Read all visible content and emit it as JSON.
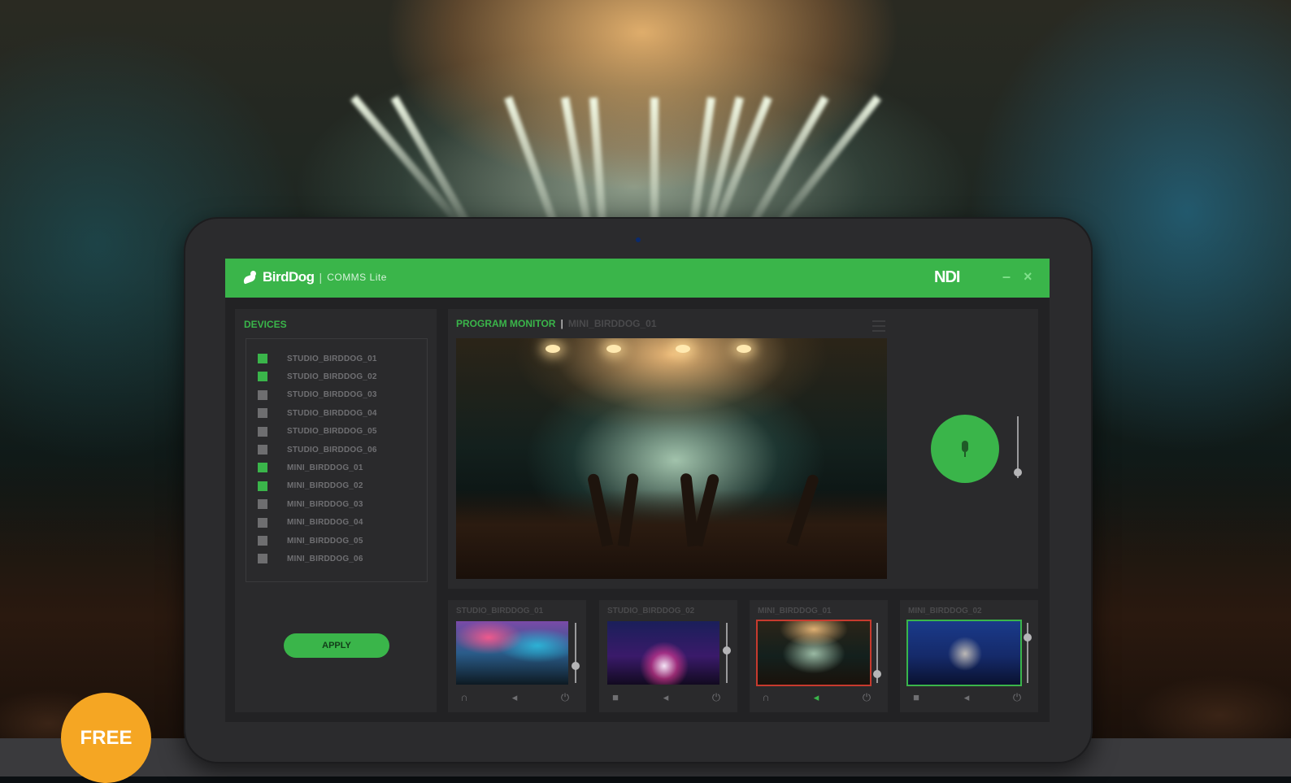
{
  "app": {
    "brand": "BirdDog",
    "separator": "|",
    "product": "COMMS Lite",
    "ndi": "NDI",
    "minimize": "–",
    "close": "×"
  },
  "devices": {
    "title": "DEVICES",
    "items": [
      {
        "label": "STUDIO_BIRDDOG_01",
        "checked": true
      },
      {
        "label": "STUDIO_BIRDDOG_02",
        "checked": true
      },
      {
        "label": "STUDIO_BIRDDOG_03",
        "checked": false
      },
      {
        "label": "STUDIO_BIRDDOG_04",
        "checked": false
      },
      {
        "label": "STUDIO_BIRDDOG_05",
        "checked": false
      },
      {
        "label": "STUDIO_BIRDDOG_06",
        "checked": false
      },
      {
        "label": "MINI_BIRDDOG_01",
        "checked": true
      },
      {
        "label": "MINI_BIRDDOG_02",
        "checked": true
      },
      {
        "label": "MINI_BIRDDOG_03",
        "checked": false
      },
      {
        "label": "MINI_BIRDDOG_04",
        "checked": false
      },
      {
        "label": "MINI_BIRDDOG_05",
        "checked": false
      },
      {
        "label": "MINI_BIRDDOG_06",
        "checked": false
      }
    ],
    "apply_label": "APPLY"
  },
  "program": {
    "label": "PROGRAM MONITOR",
    "divider": "|",
    "source": "MINI_BIRDDOG_01"
  },
  "sources": [
    {
      "name": "STUDIO_BIRDDOG_01",
      "icons": [
        "headset-icon",
        "speaker-icon",
        "power-icon"
      ],
      "active_icon": -1,
      "border": "none",
      "level": 0.25
    },
    {
      "name": "STUDIO_BIRDDOG_02",
      "icons": [
        "camera-icon",
        "speaker-icon",
        "power-icon"
      ],
      "active_icon": -1,
      "border": "none",
      "level": 0.55
    },
    {
      "name": "MINI_BIRDDOG_01",
      "icons": [
        "headset-icon",
        "speaker-icon",
        "power-icon"
      ],
      "active_icon": 1,
      "border": "red",
      "level": 0.1
    },
    {
      "name": "MINI_BIRDDOG_02",
      "icons": [
        "camera-icon",
        "speaker-icon",
        "power-icon"
      ],
      "active_icon": -1,
      "border": "green",
      "level": 0.8
    }
  ],
  "badge": "FREE",
  "colors": {
    "accent": "#3ab54a",
    "program_border": "#c73a2e",
    "badge": "#f5a623"
  }
}
